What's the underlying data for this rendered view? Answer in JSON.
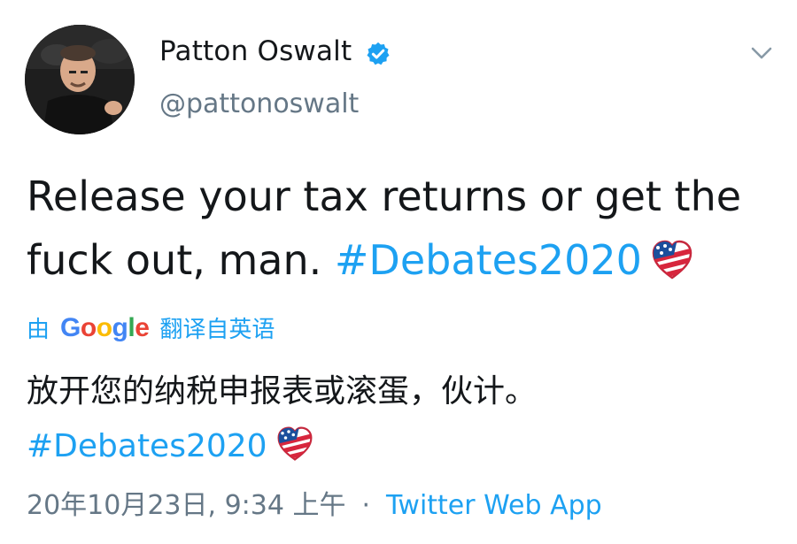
{
  "author": {
    "display_name": "Patton Oswalt",
    "handle": "@pattonoswalt",
    "verified": true
  },
  "tweet": {
    "text": "Release your tax returns or get the fuck out, man.",
    "hashtag": "#Debates2020"
  },
  "translation": {
    "prefix": "由",
    "provider": "Google",
    "suffix": "翻译自英语",
    "text": "放开您的纳税申报表或滚蛋，伙计。",
    "hashtag": "#Debates2020"
  },
  "meta": {
    "timestamp": "20年10月23日, 9:34 上午",
    "separator": "·",
    "source": "Twitter Web App"
  },
  "icons": {
    "verified": "verified-badge-icon",
    "menu": "chevron-down-icon",
    "hashtag_emoji": "debates-flag-heart-icon"
  },
  "colors": {
    "link": "#1da1f2",
    "secondary": "#657786",
    "text": "#14171a"
  }
}
